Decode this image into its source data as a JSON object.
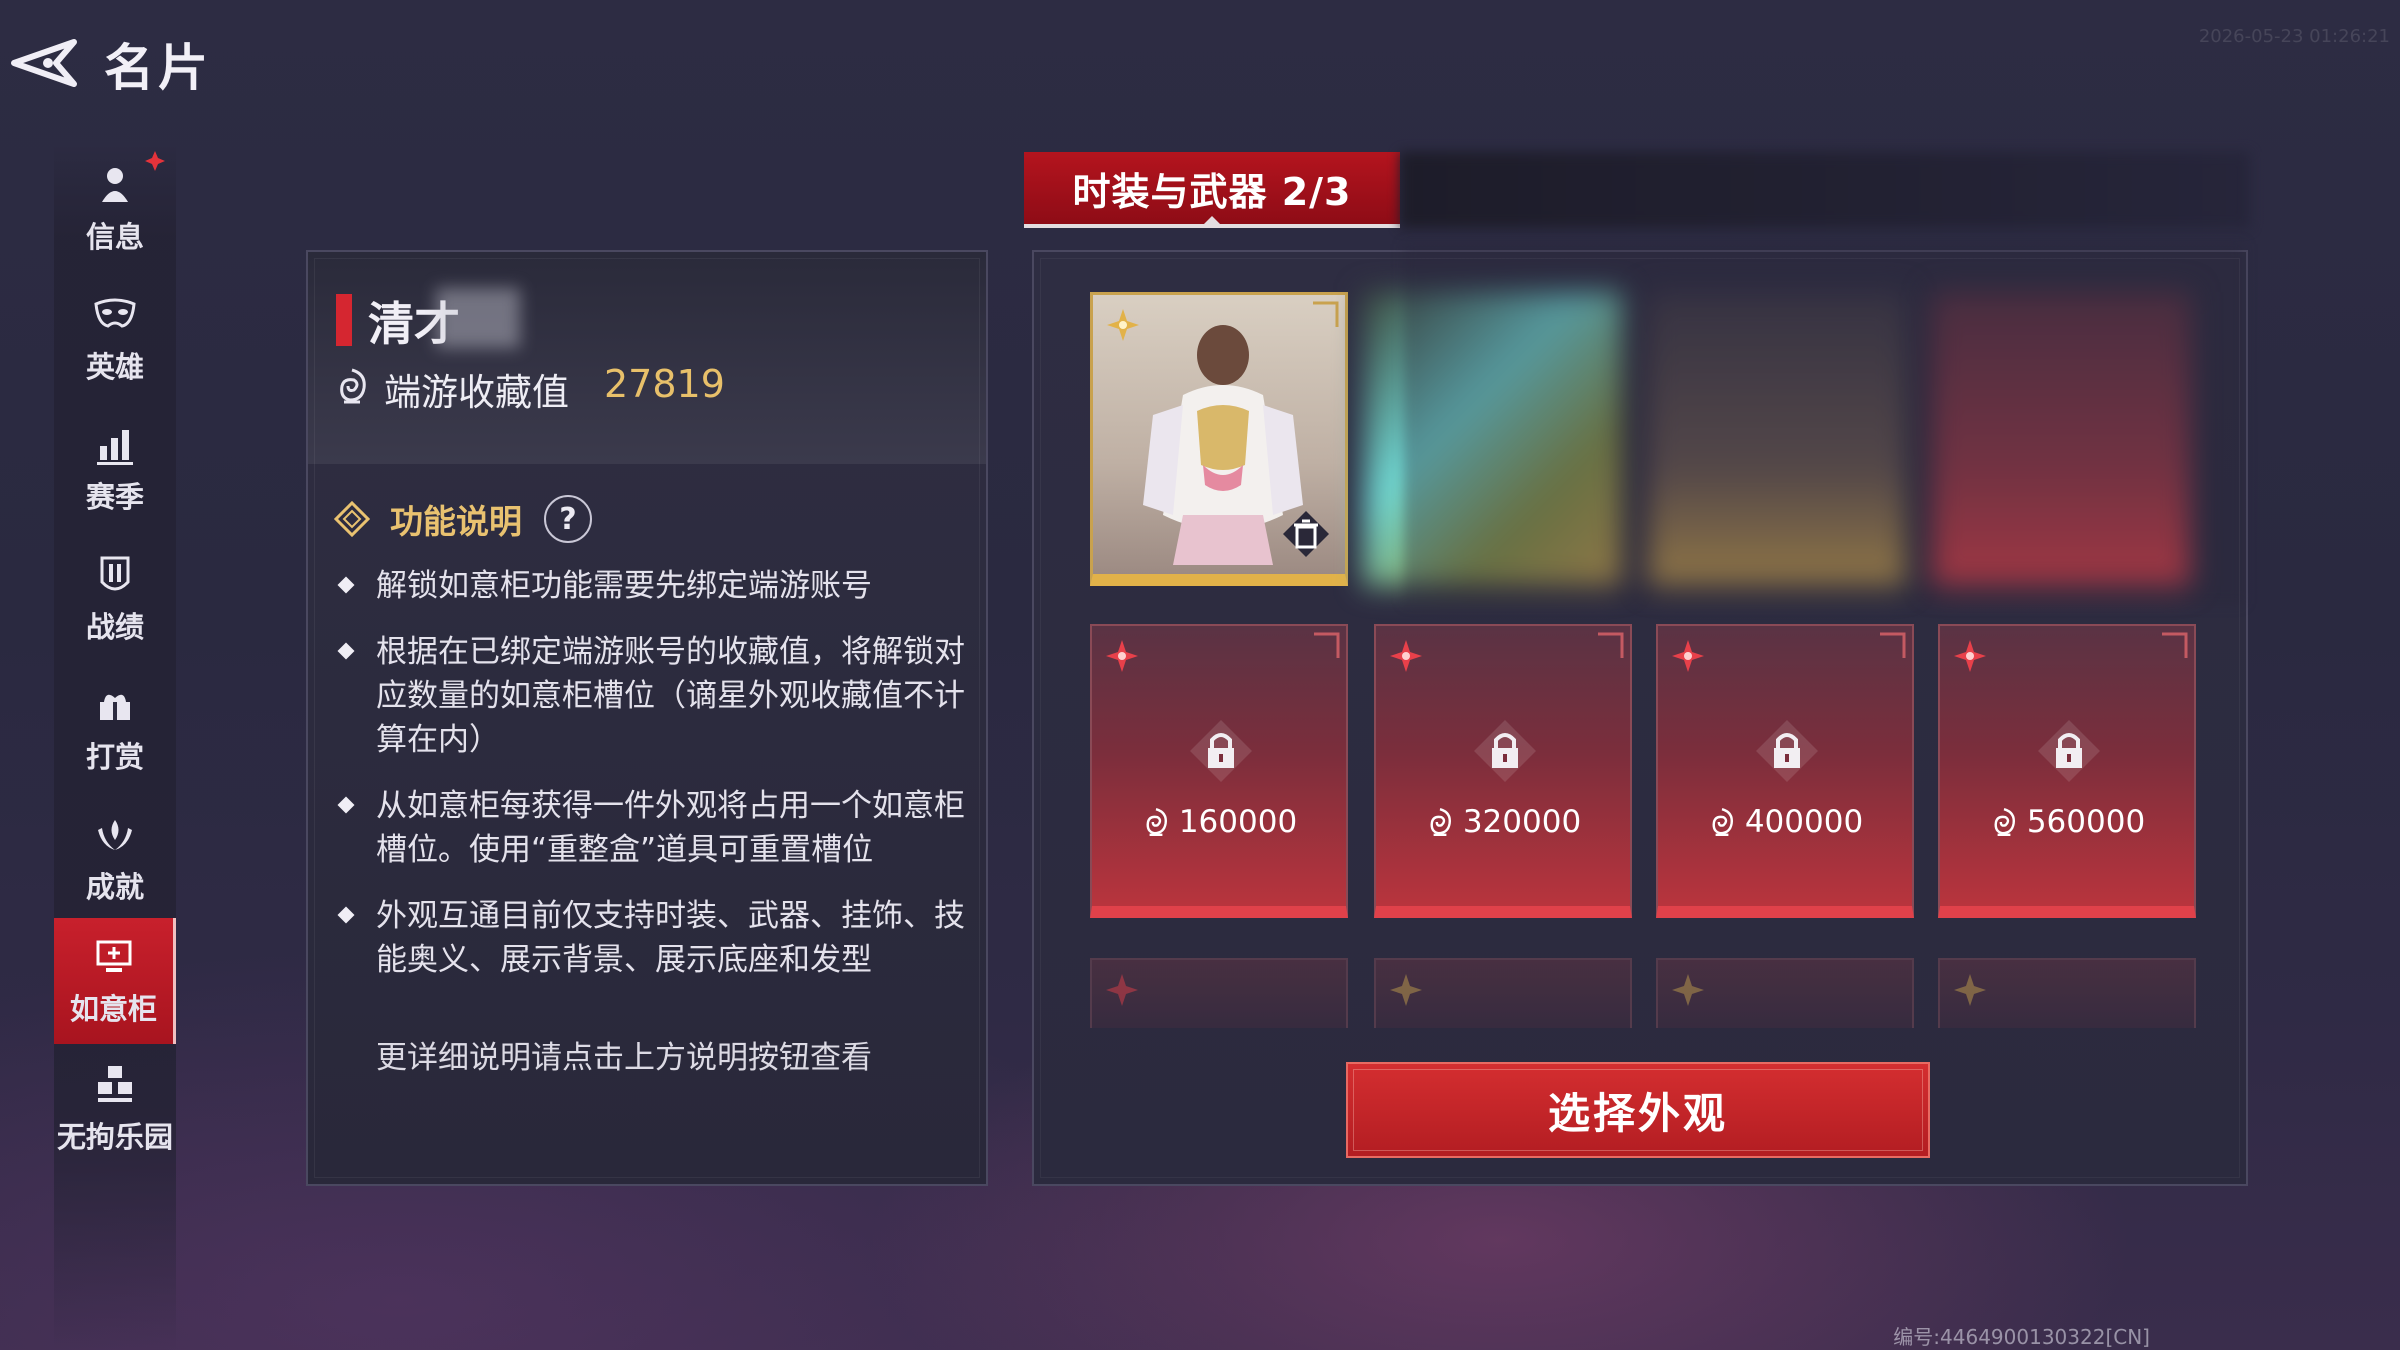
{
  "header": {
    "title": "名片",
    "timestamp": "2026-05-23 01:26:21",
    "serial": "编号:4464900130322[CN]"
  },
  "sidebar": {
    "items": [
      {
        "label": "信息",
        "icon": "person-icon",
        "badge": true
      },
      {
        "label": "英雄",
        "icon": "mask-icon"
      },
      {
        "label": "赛季",
        "icon": "bar-chart-icon"
      },
      {
        "label": "战绩",
        "icon": "shield-icon"
      },
      {
        "label": "打赏",
        "icon": "gift-icon"
      },
      {
        "label": "成就",
        "icon": "laurel-icon"
      },
      {
        "label": "如意柜",
        "icon": "cabinet-icon",
        "active": true
      },
      {
        "label": "无拘乐园",
        "icon": "cubes-icon"
      }
    ]
  },
  "profile": {
    "name": "清才",
    "collection_label": "端游收藏值",
    "collection_value": "27819"
  },
  "function": {
    "title": "功能说明",
    "help_label": "?",
    "rules": [
      "解锁如意柜功能需要先绑定端游账号",
      "根据在已绑定端游账号的收藏值，将解锁对应数量的如意柜槽位（谪星外观收藏值不计算在内）",
      "从如意柜每获得一件外观将占用一个如意柜槽位。使用“重整盒”道具可重置槽位",
      "外观互通目前仅支持时装、武器、挂饰、技能奥义、展示背景、展示底座和发型"
    ],
    "more_note": "更详细说明请点击上方说明按钮查看"
  },
  "tabs": {
    "active_label": "时装与武器 2/3"
  },
  "slots": {
    "locked": [
      {
        "cost": "160000"
      },
      {
        "cost": "320000"
      },
      {
        "cost": "400000"
      },
      {
        "cost": "560000"
      }
    ]
  },
  "actions": {
    "select_label": "选择外观"
  },
  "colors": {
    "accent_red": "#c8202c",
    "gold": "#e8c06a",
    "locked_slot": "#b8343d",
    "owned_border": "#e2b249"
  }
}
